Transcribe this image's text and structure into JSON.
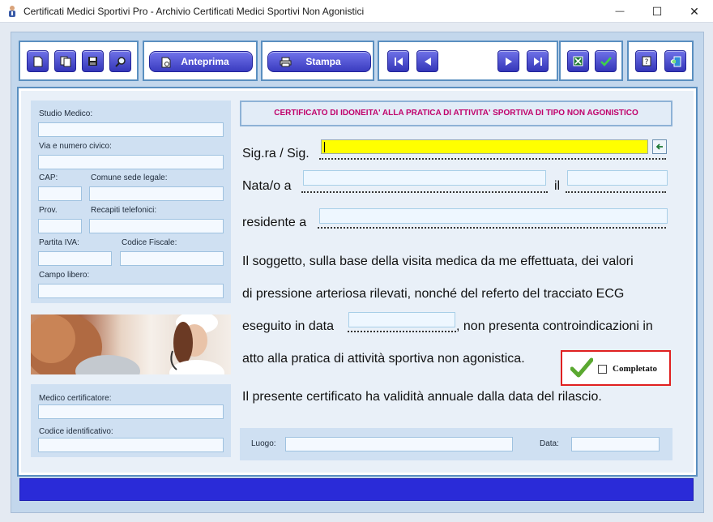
{
  "window": {
    "title": "Certificati Medici Sportivi Pro - Archivio Certificati Medici Sportivi Non Agonistici",
    "minimize": "—",
    "maximize": "☐",
    "close": "✕"
  },
  "toolbar": {
    "preview_label": "Anteprima",
    "print_label": "Stampa",
    "icons": [
      "new-icon",
      "copy-icon",
      "save-icon",
      "search-icon",
      "preview-icon",
      "print-icon",
      "first-record-icon",
      "previous-record-icon",
      "next-record-icon",
      "last-record-icon",
      "excel-icon",
      "confirm-icon",
      "help-icon",
      "exit-icon"
    ]
  },
  "left": {
    "studio_label": "Studio Medico:",
    "address_label": "Via e numero civico:",
    "cap_label": "CAP:",
    "comune_label": "Comune sede legale:",
    "prov_label": "Prov.",
    "phone_label": "Recapiti telefonici:",
    "vat_label": "Partita IVA:",
    "tax_code_label": "Codice Fiscale:",
    "free_label": "Campo libero:",
    "doctor_label": "Medico certificatore:",
    "doctor_id_label": "Codice identificativo:"
  },
  "certificate": {
    "title": "CERTIFICATO DI IDONEITA' ALLA PRATICA DI ATTIVITA' SPORTIVA DI TIPO NON AGONISTICO",
    "name_prefix": "Sig.ra / Sig.",
    "born_prefix": "Nata/o a",
    "born_on": "il",
    "resident_prefix": "residente a",
    "line1": "Il soggetto, sulla base della visita medica da me effettuata, dei valori",
    "line2": "di pressione arteriosa rilevati, nonché del referto del tracciato ECG",
    "line3a": "eseguito in data",
    "line3b": ", non presenta controindicazioni in",
    "line4": "atto alla pratica di attività sportiva non agonistica.",
    "validity": "Il presente certificato ha validità annuale dalla data del rilascio.",
    "completed_label": "Completato",
    "completed_checked": false,
    "place_label": "Luogo:",
    "date_label": "Data:"
  },
  "colors": {
    "accent": "#3436b8",
    "status_bar": "#2a2bd8",
    "title_text": "#c0006a",
    "highlight": "#ffff00",
    "completed_border": "#e02020"
  }
}
